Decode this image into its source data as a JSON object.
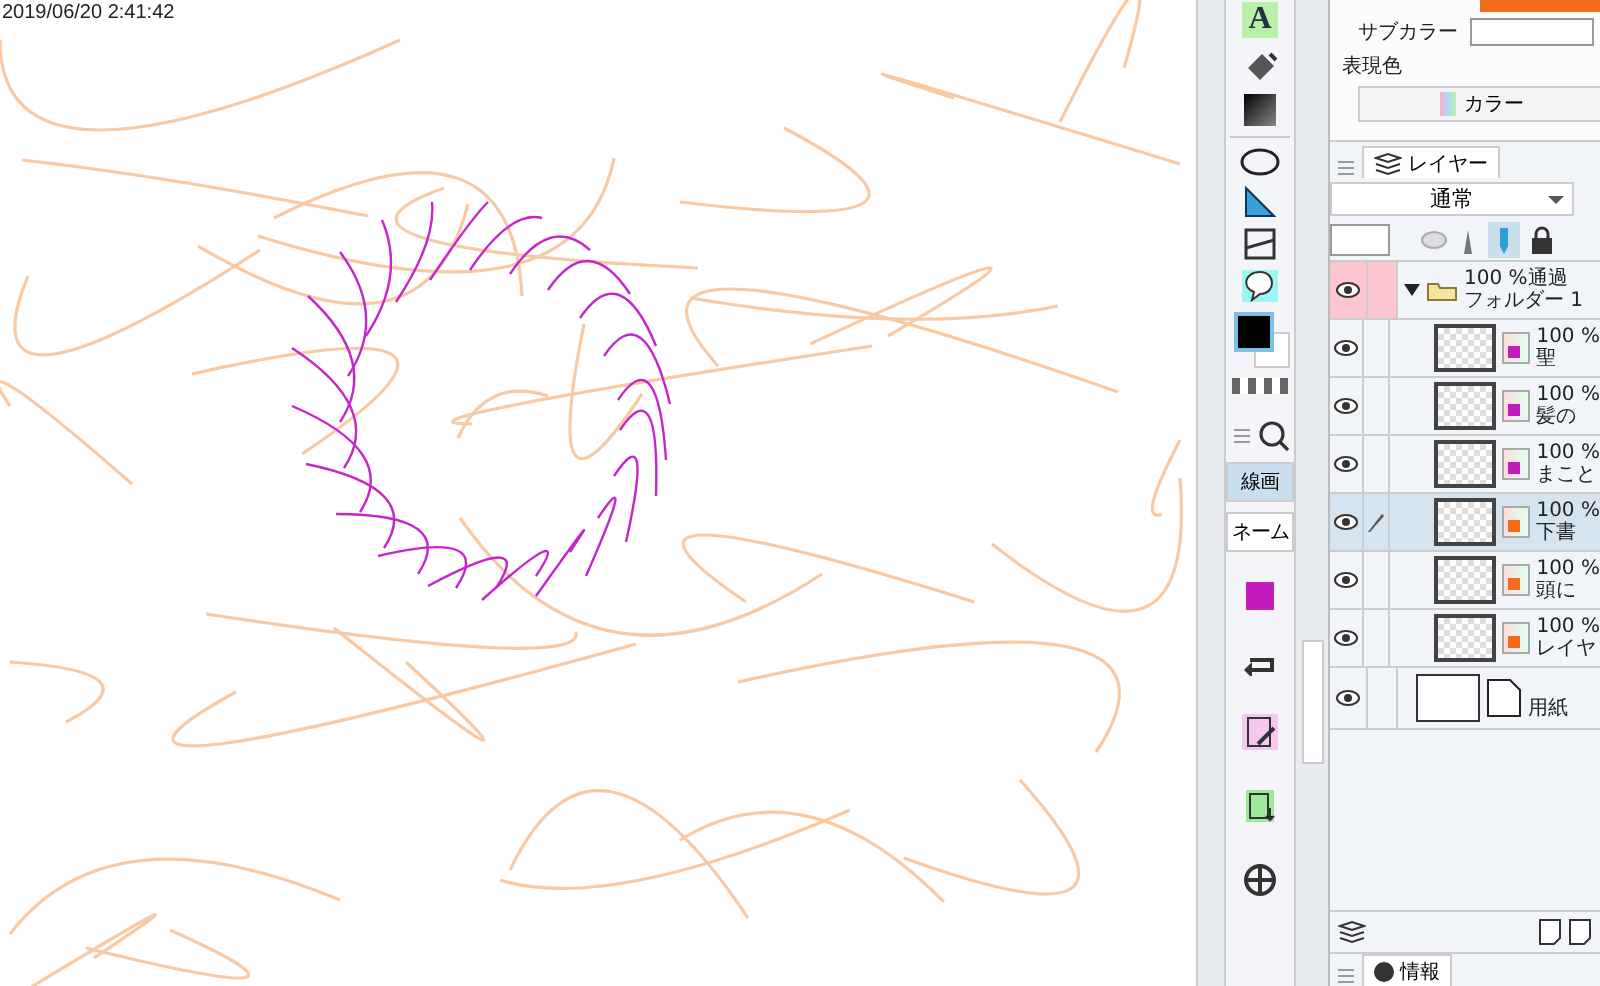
{
  "canvas": {
    "timestamp": "2019/06/20 2:41:42"
  },
  "tools": {
    "text_tool_glyph": "A",
    "subtool_tabs": [
      {
        "label": "線画",
        "selected": true
      },
      {
        "label": "ネーム",
        "selected": false
      }
    ]
  },
  "color_panel": {
    "sub_color_label": "サブカラー",
    "expression_label": "表現色",
    "expression_button": "カラー"
  },
  "layer_panel": {
    "tab": "レイヤー",
    "blend_mode": "通常",
    "layers": [
      {
        "kind": "folder",
        "opacity": "100 %通過",
        "name": "フォルダー 1",
        "visible": true,
        "expanded": true,
        "selected": false,
        "children": [
          {
            "kind": "raster",
            "opacity": "100 %",
            "name": "聖",
            "visible": true,
            "selected": false,
            "color": "#c31bbd"
          },
          {
            "kind": "raster",
            "opacity": "100 %",
            "name": "髪の",
            "visible": true,
            "selected": false,
            "color": "#c31bbd"
          },
          {
            "kind": "raster",
            "opacity": "100 %",
            "name": "まこと",
            "visible": true,
            "selected": false,
            "color": "#c31bbd"
          },
          {
            "kind": "raster",
            "opacity": "100 %",
            "name": "下書",
            "visible": true,
            "selected": true,
            "color": "#f26b1d"
          },
          {
            "kind": "raster",
            "opacity": "100 %",
            "name": "頭に",
            "visible": true,
            "selected": false,
            "color": "#f26b1d"
          },
          {
            "kind": "raster",
            "opacity": "100 %",
            "name": "レイヤ",
            "visible": true,
            "selected": false,
            "color": "#f26b1d"
          }
        ]
      },
      {
        "kind": "paper",
        "name": "用紙",
        "visible": true,
        "selected": false
      }
    ]
  },
  "info_tab": "情報"
}
